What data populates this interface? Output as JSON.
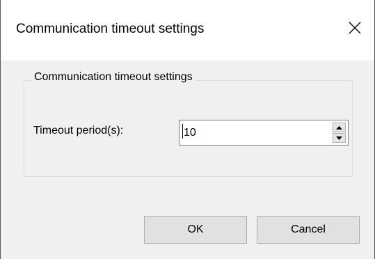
{
  "window": {
    "title": "Communication timeout settings"
  },
  "group": {
    "legend": "Communication timeout settings",
    "timeout_label": "Timeout period(s):",
    "timeout_value": "10"
  },
  "buttons": {
    "ok_label": "OK",
    "cancel_label": "Cancel"
  },
  "icons": {
    "close": "close-icon",
    "spin_up": "triangle-up-icon",
    "spin_down": "triangle-down-icon"
  },
  "colors": {
    "dialog_background": "#f0f0f0",
    "titlebar_background": "#ffffff",
    "button_background": "#e1e1e1",
    "button_border": "#adadad"
  }
}
